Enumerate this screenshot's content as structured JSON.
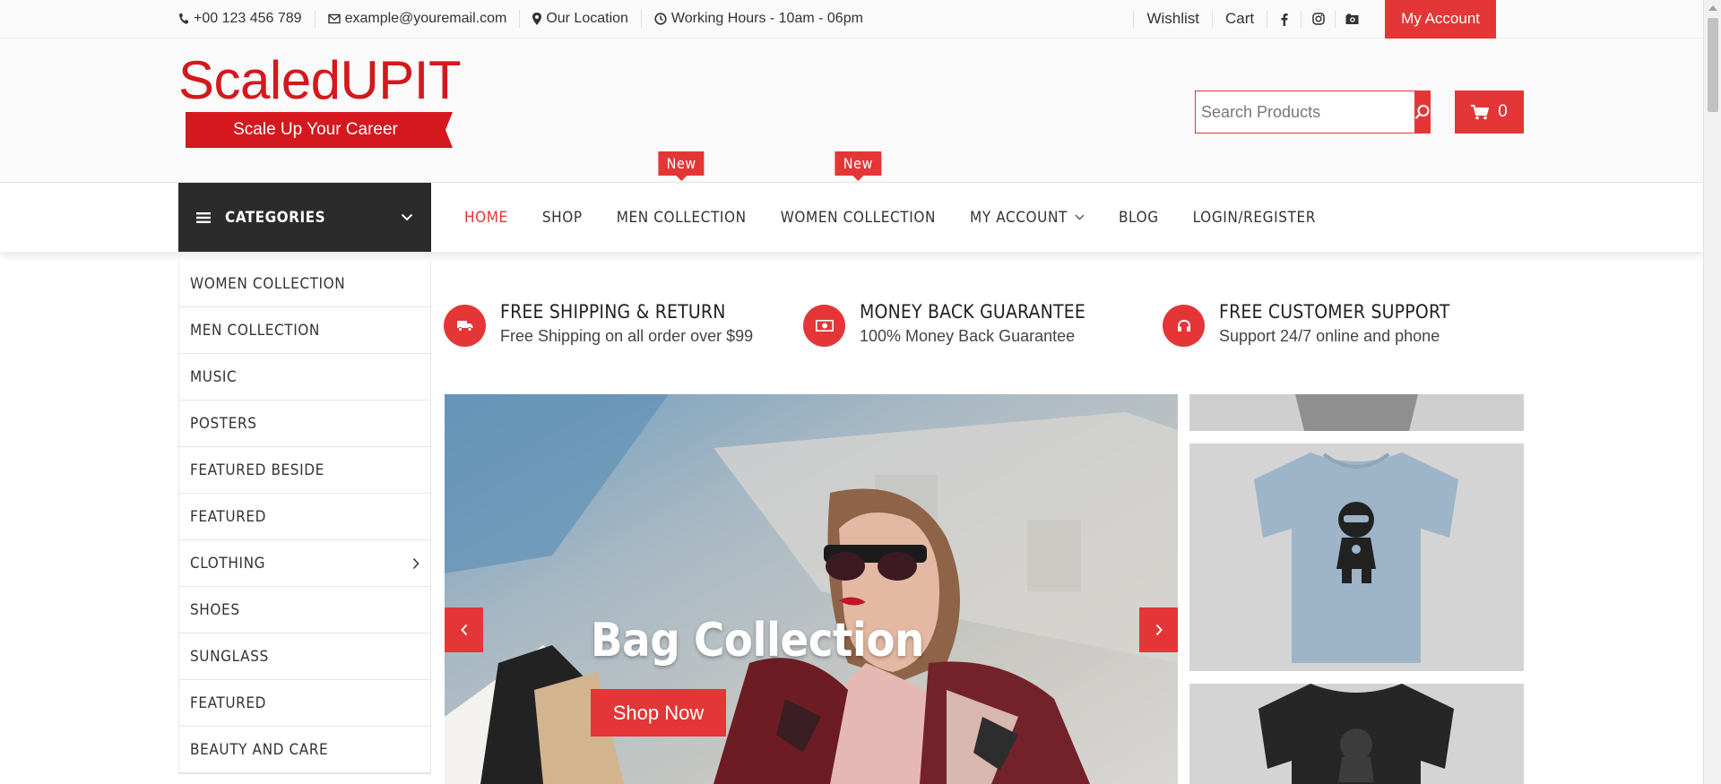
{
  "topbar": {
    "phone": "+00 123 456 789",
    "email": "example@youremail.com",
    "location": "Our Location",
    "hours": "Working Hours - 10am - 06pm",
    "wishlist": "Wishlist",
    "cart": "Cart",
    "account": "My Account",
    "social": [
      "facebook-icon",
      "instagram-icon",
      "camera-icon"
    ]
  },
  "header": {
    "logo_title": "ScaledUPIT",
    "logo_tagline": "Scale Up Your Career",
    "search_placeholder": "Search Products",
    "cart_count": "0"
  },
  "nav": {
    "categories_label": "CATEGORIES",
    "items": [
      {
        "label": "HOME",
        "active": true
      },
      {
        "label": "SHOP"
      },
      {
        "label": "MEN COLLECTION",
        "badge": "New"
      },
      {
        "label": "WOMEN COLLECTION",
        "badge": "New"
      },
      {
        "label": "MY ACCOUNT",
        "dropdown": true
      },
      {
        "label": "BLOG"
      },
      {
        "label": "LOGIN/REGISTER"
      }
    ]
  },
  "sidebar": {
    "items": [
      {
        "label": "WOMEN COLLECTION"
      },
      {
        "label": "MEN COLLECTION"
      },
      {
        "label": "MUSIC"
      },
      {
        "label": "POSTERS"
      },
      {
        "label": "FEATURED BESIDE"
      },
      {
        "label": "FEATURED"
      },
      {
        "label": "CLOTHING",
        "submenu": true
      },
      {
        "label": "SHOES"
      },
      {
        "label": "SUNGLASS"
      },
      {
        "label": "FEATURED"
      },
      {
        "label": "BEAUTY AND CARE"
      }
    ]
  },
  "features": [
    {
      "title": "FREE SHIPPING & RETURN",
      "subtitle": "Free Shipping on all order over $99",
      "icon": "truck-icon"
    },
    {
      "title": "MONEY BACK GUARANTEE",
      "subtitle": "100% Money Back Guarantee",
      "icon": "money-icon"
    },
    {
      "title": "FREE CUSTOMER SUPPORT",
      "subtitle": "Support 24/7 online and phone",
      "icon": "headphones-icon"
    }
  ],
  "slider": {
    "title": "Bag Collection",
    "button": "Shop Now"
  },
  "colors": {
    "accent": "#e53637",
    "logo_red": "#d4181d",
    "dark": "#2b2b2b"
  }
}
